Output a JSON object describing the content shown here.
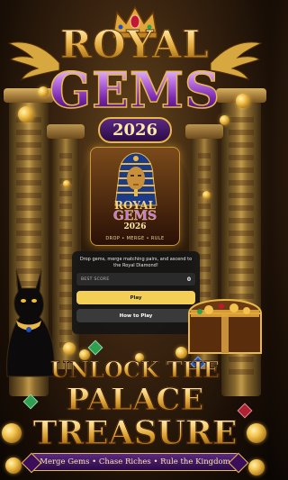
{
  "title": {
    "line1": "ROYAL",
    "line2": "GEMS",
    "year": "2026"
  },
  "logo": {
    "line1": "ROYAL",
    "line2": "GEMS",
    "year": "2026",
    "tagline": "DROP • MERGE • RULE"
  },
  "panel": {
    "description": "Drop gems, merge matching pairs, and ascend to the Royal Diamond!",
    "best_score_label": "BEST SCORE",
    "best_score_value": "0",
    "play_label": "Play",
    "how_to_play_label": "How to Play"
  },
  "banner": {
    "line1": "UNLOCK THE",
    "line2": "PALACE",
    "line3": "TREASURE",
    "ribbon": "Merge Gems • Chase Riches • Rule the Kingdom"
  },
  "colors": {
    "accent_gold": "#f3cf56",
    "accent_purple": "#7a2ab0",
    "panel_bg": "#161616"
  },
  "icons": [
    "crown-icon",
    "wing-icon",
    "pharaoh-icon",
    "cat-icon",
    "treasure-chest-icon",
    "coin-icon",
    "gem-icon"
  ]
}
